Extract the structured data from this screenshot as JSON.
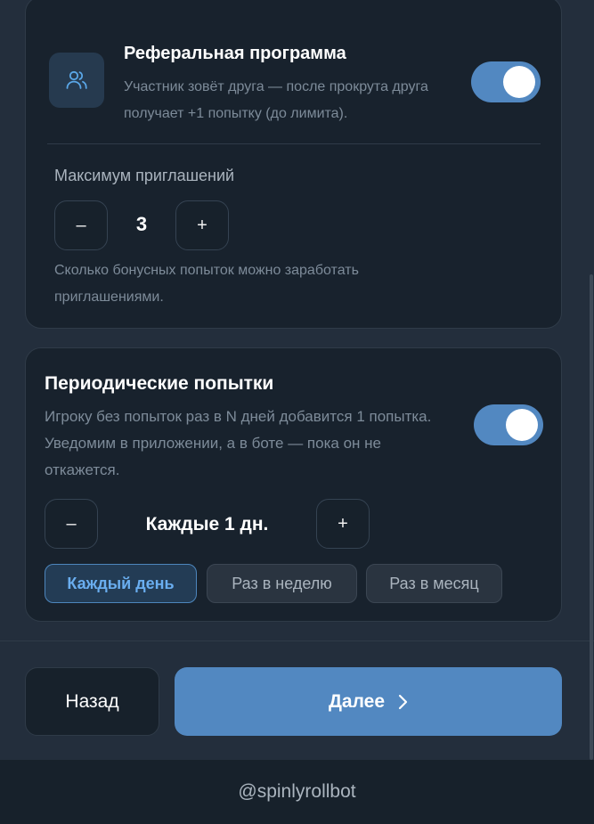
{
  "referral": {
    "title": "Реферальная программа",
    "description": "Участник зовёт друга — после прокрута друга получает +1 попытку (до лимита).",
    "enabled": true,
    "icon": "users-icon",
    "max_invites_label": "Максимум приглашений",
    "max_invites_value": "3",
    "minus_label": "–",
    "plus_label": "+",
    "hint": "Сколько бонусных попыток можно заработать приглашениями."
  },
  "periodic": {
    "title": "Периодические попытки",
    "description": "Игроку без попыток раз в N дней добавится 1 попытка. Уведомим в приложении, а в боте — пока он не откажется.",
    "enabled": true,
    "interval_value": "Каждые 1 дн.",
    "minus_label": "–",
    "plus_label": "+",
    "presets": [
      {
        "label": "Каждый день",
        "selected": true
      },
      {
        "label": "Раз в неделю",
        "selected": false
      },
      {
        "label": "Раз в месяц",
        "selected": false
      }
    ]
  },
  "nav": {
    "back_label": "Назад",
    "next_label": "Далее",
    "next_icon": "chevron-right-icon"
  },
  "footer": {
    "bot_handle": "@spinlyrollbot"
  },
  "colors": {
    "accent": "#5288c1",
    "card": "#18222d",
    "background": "#232e3c"
  }
}
